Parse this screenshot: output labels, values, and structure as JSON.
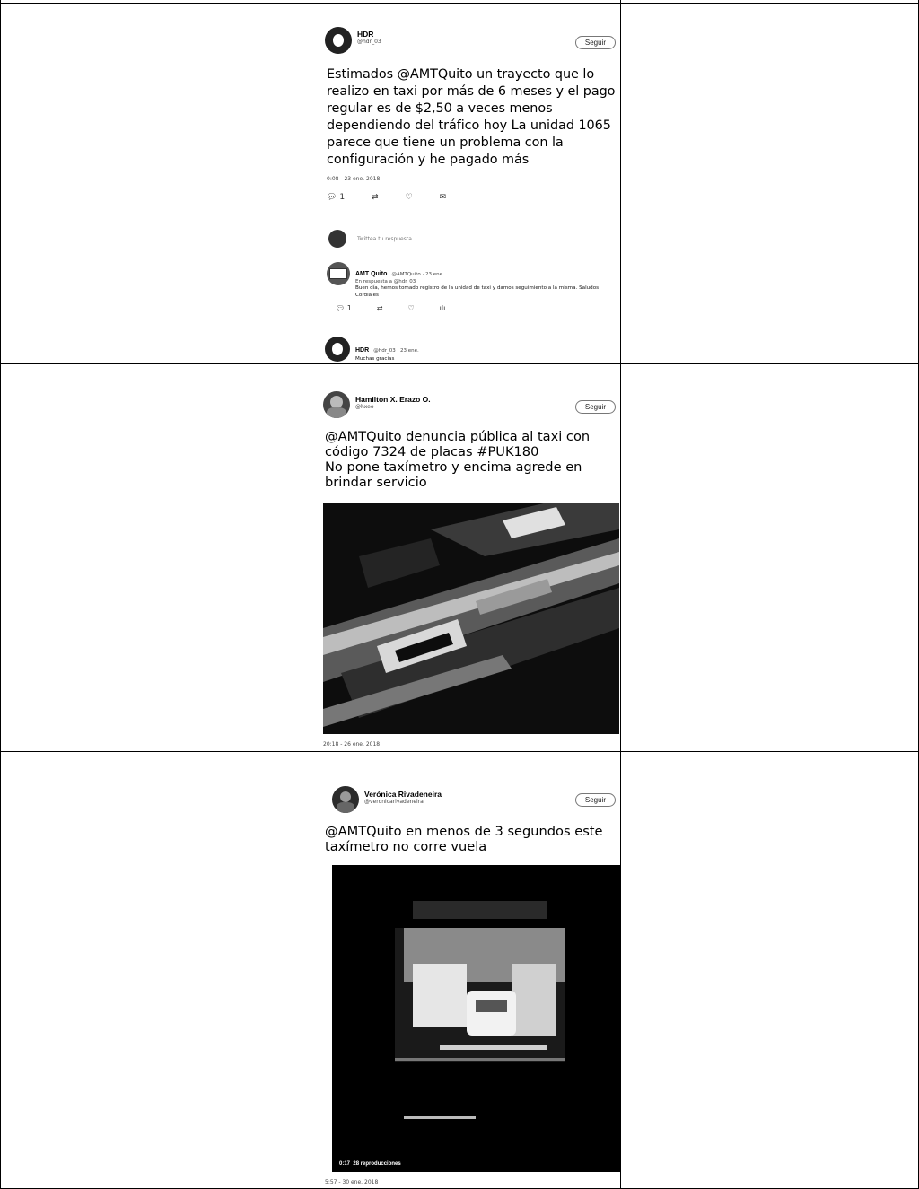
{
  "tweets": [
    {
      "author": "HDR",
      "handle": "@hdr_03",
      "follow_label": "Seguir",
      "text": "Estimados @AMTQuito un trayecto que lo realizo en taxi por más de 6 meses y el pago regular es de $2,50  a veces menos dependiendo del tráfico hoy La unidad 1065 parece que tiene un problema con la configuración y he pagado más",
      "timestamp": "0:08 - 23 ene. 2018",
      "reply_count": "1",
      "reply_prompt": "Twittea tu respuesta",
      "replies": [
        {
          "author": "AMT Quito",
          "meta": "@AMTQuito · 23 ene.",
          "in_reply_to": "En respuesta a @hdr_03",
          "text": "Buen día, hemos tomado registro de la unidad de taxi y damos seguimiento a la misma. Saludos Cordiales",
          "reply_count": "1",
          "icon": "stats-icon"
        },
        {
          "author": "HDR",
          "meta": "@hdr_03 · 23 ene.",
          "text": "Muchas gracias"
        }
      ]
    },
    {
      "author": "Hamilton X. Erazo O.",
      "handle": "@hxeo",
      "follow_label": "Seguir",
      "text_lines": [
        "@AMTQuito denuncia pública al taxi con",
        "código 7324 de placas  #PUK180",
        "No pone taxímetro y encima agrede en",
        "brindar servicio"
      ],
      "timestamp": "20:18 - 26 ene. 2018"
    },
    {
      "author": "Verónica Rivadeneira",
      "handle": "@veronicarivadeneira",
      "follow_label": "Seguir",
      "text_lines": [
        "@AMTQuito en menos de 3 segundos este",
        "taxímetro no corre vuela"
      ],
      "video_duration": "0:17",
      "video_views": "28 reproducciones",
      "timestamp": "5:57 - 30 ene. 2018"
    }
  ]
}
